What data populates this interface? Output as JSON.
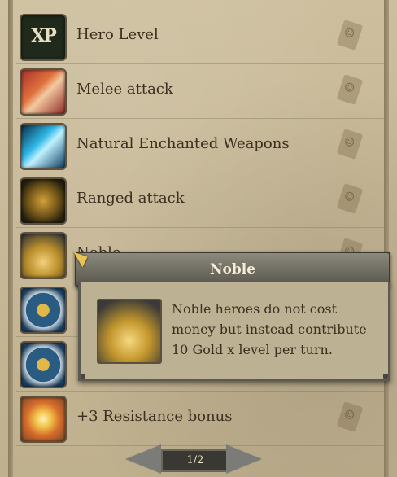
{
  "abilities": [
    {
      "label": "Hero Level",
      "icon": "hero-level-icon",
      "icon_text": "XP"
    },
    {
      "label": "Melee attack",
      "icon": "melee-attack-icon"
    },
    {
      "label": "Natural Enchanted Weapons",
      "icon": "natural-enchanted-weapons-icon"
    },
    {
      "label": "Ranged attack",
      "icon": "ranged-attack-icon"
    },
    {
      "label": "Noble",
      "icon": "noble-icon"
    },
    {
      "label": "",
      "icon": "shield-icon"
    },
    {
      "label": "",
      "icon": "shield-icon"
    },
    {
      "label": "+3 Resistance bonus",
      "icon": "resistance-bonus-icon"
    }
  ],
  "tooltip": {
    "title": "Noble",
    "description": "Noble heroes do not cost money but instead contribute 10 Gold x level per turn.",
    "icon": "gold-coins-icon"
  },
  "pager": {
    "label": "1/2"
  }
}
